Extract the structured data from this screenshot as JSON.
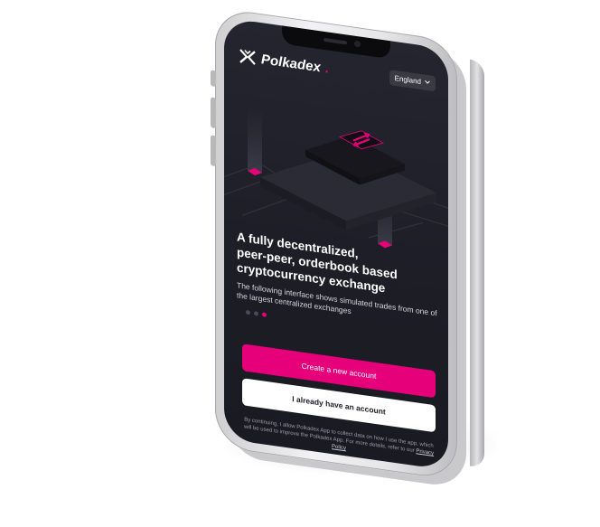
{
  "header": {
    "brand": "Polkadex",
    "brand_dot": ".",
    "language": "England"
  },
  "hero": {
    "headline_line1": "A fully decentralized,",
    "headline_line2": "peer-peer, orderbook based",
    "headline_line3": "cryptocurrency exchange",
    "subtitle": "The following interface shows simulated trades from one of the largest centralized exchanges"
  },
  "carousel": {
    "active_index": 2,
    "count": 3
  },
  "actions": {
    "create_account": "Create a new account",
    "have_account": "I already have an account"
  },
  "legal": {
    "text": "By continuing, I allow Polkadex App to collect data on how I use the app, which will be used to improve the Polkadex App. For more details, refer to our",
    "link": "Privacy Policy"
  },
  "colors": {
    "accent": "#e6007a",
    "background": "#1d1d26",
    "button_secondary": "#ffffff"
  },
  "icons": {
    "logo": "polkadex-logo-icon",
    "language_chevron": "chevron-down-icon",
    "swap": "swap-arrows-icon"
  }
}
